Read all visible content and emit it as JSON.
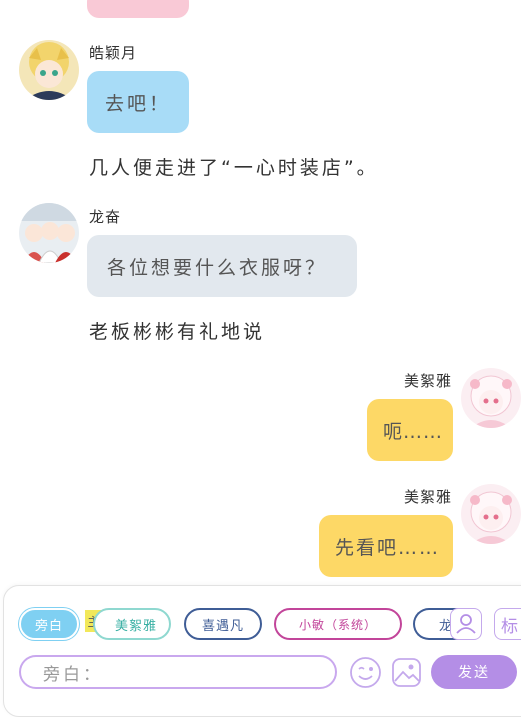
{
  "messages": {
    "m1": {
      "name": "皓颖月",
      "text": "去吧！"
    },
    "n1": {
      "text": "几人便走进了“一心时装店”。"
    },
    "m2": {
      "name": "龙奋",
      "text": "各位想要什么衣服呀？"
    },
    "n2": {
      "text": "老板彬彬有礼地说"
    },
    "m3": {
      "name": "美絮雅",
      "text": "呃……"
    },
    "m4": {
      "name": "美絮雅",
      "text": "先看吧……"
    }
  },
  "composer": {
    "roles": [
      {
        "label": "旁白",
        "active": true
      },
      {
        "label": "美絮雅",
        "badge": "主"
      },
      {
        "label": "喜遇凡"
      },
      {
        "label": "小敏（系统）"
      },
      {
        "label": "龙"
      }
    ],
    "tag_button": "标",
    "input_placeholder": "旁白：",
    "send_label": "发送"
  },
  "colors": {
    "blue_bubble": "#a8dcf7",
    "gray_bubble": "#e2e8ee",
    "yellow_bubble": "#fdd866",
    "pink_bubble": "#f9c9d6",
    "accent_purple": "#b48ee6",
    "chip_active": "#7fd0f2"
  }
}
